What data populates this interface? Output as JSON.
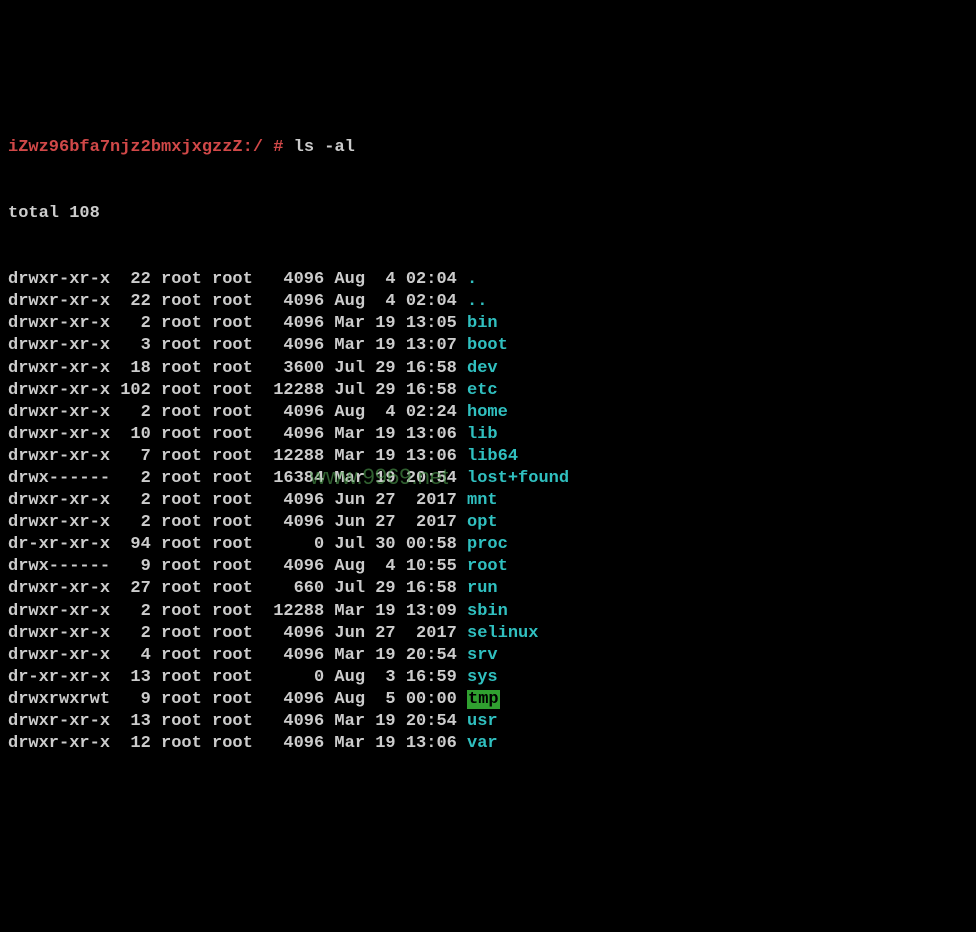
{
  "prompt": "iZwz96bfa7njz2bmxjxgzzZ:/ # ",
  "command": "ls -al",
  "total_line": "total 108",
  "listing": [
    {
      "perms": "drwxr-xr-x",
      "links": "22",
      "owner": "root",
      "group": "root",
      "size": "4096",
      "date": "Aug  4 02:04",
      "name": ".",
      "cls": "name-dir"
    },
    {
      "perms": "drwxr-xr-x",
      "links": "22",
      "owner": "root",
      "group": "root",
      "size": "4096",
      "date": "Aug  4 02:04",
      "name": "..",
      "cls": "name-dir"
    },
    {
      "perms": "drwxr-xr-x",
      "links": "2",
      "owner": "root",
      "group": "root",
      "size": "4096",
      "date": "Mar 19 13:05",
      "name": "bin",
      "cls": "name-dir"
    },
    {
      "perms": "drwxr-xr-x",
      "links": "3",
      "owner": "root",
      "group": "root",
      "size": "4096",
      "date": "Mar 19 13:07",
      "name": "boot",
      "cls": "name-dir"
    },
    {
      "perms": "drwxr-xr-x",
      "links": "18",
      "owner": "root",
      "group": "root",
      "size": "3600",
      "date": "Jul 29 16:58",
      "name": "dev",
      "cls": "name-dir"
    },
    {
      "perms": "drwxr-xr-x",
      "links": "102",
      "owner": "root",
      "group": "root",
      "size": "12288",
      "date": "Jul 29 16:58",
      "name": "etc",
      "cls": "name-dir"
    },
    {
      "perms": "drwxr-xr-x",
      "links": "2",
      "owner": "root",
      "group": "root",
      "size": "4096",
      "date": "Aug  4 02:24",
      "name": "home",
      "cls": "name-dir"
    },
    {
      "perms": "drwxr-xr-x",
      "links": "10",
      "owner": "root",
      "group": "root",
      "size": "4096",
      "date": "Mar 19 13:06",
      "name": "lib",
      "cls": "name-dir"
    },
    {
      "perms": "drwxr-xr-x",
      "links": "7",
      "owner": "root",
      "group": "root",
      "size": "12288",
      "date": "Mar 19 13:06",
      "name": "lib64",
      "cls": "name-dir"
    },
    {
      "perms": "drwx------",
      "links": "2",
      "owner": "root",
      "group": "root",
      "size": "16384",
      "date": "Mar 19 20:54",
      "name": "lost+found",
      "cls": "name-dir"
    },
    {
      "perms": "drwxr-xr-x",
      "links": "2",
      "owner": "root",
      "group": "root",
      "size": "4096",
      "date": "Jun 27  2017",
      "name": "mnt",
      "cls": "name-dir"
    },
    {
      "perms": "drwxr-xr-x",
      "links": "2",
      "owner": "root",
      "group": "root",
      "size": "4096",
      "date": "Jun 27  2017",
      "name": "opt",
      "cls": "name-dir"
    },
    {
      "perms": "dr-xr-xr-x",
      "links": "94",
      "owner": "root",
      "group": "root",
      "size": "0",
      "date": "Jul 30 00:58",
      "name": "proc",
      "cls": "name-dir"
    },
    {
      "perms": "drwx------",
      "links": "9",
      "owner": "root",
      "group": "root",
      "size": "4096",
      "date": "Aug  4 10:55",
      "name": "root",
      "cls": "name-dir"
    },
    {
      "perms": "drwxr-xr-x",
      "links": "27",
      "owner": "root",
      "group": "root",
      "size": "660",
      "date": "Jul 29 16:58",
      "name": "run",
      "cls": "name-dir"
    },
    {
      "perms": "drwxr-xr-x",
      "links": "2",
      "owner": "root",
      "group": "root",
      "size": "12288",
      "date": "Mar 19 13:09",
      "name": "sbin",
      "cls": "name-dir"
    },
    {
      "perms": "drwxr-xr-x",
      "links": "2",
      "owner": "root",
      "group": "root",
      "size": "4096",
      "date": "Jun 27  2017",
      "name": "selinux",
      "cls": "name-dir"
    },
    {
      "perms": "drwxr-xr-x",
      "links": "4",
      "owner": "root",
      "group": "root",
      "size": "4096",
      "date": "Mar 19 20:54",
      "name": "srv",
      "cls": "name-dir"
    },
    {
      "perms": "dr-xr-xr-x",
      "links": "13",
      "owner": "root",
      "group": "root",
      "size": "0",
      "date": "Aug  3 16:59",
      "name": "sys",
      "cls": "name-dir"
    },
    {
      "perms": "drwxrwxrwt",
      "links": "9",
      "owner": "root",
      "group": "root",
      "size": "4096",
      "date": "Aug  5 00:00",
      "name": "tmp",
      "cls": "name-sticky"
    },
    {
      "perms": "drwxr-xr-x",
      "links": "13",
      "owner": "root",
      "group": "root",
      "size": "4096",
      "date": "Mar 19 20:54",
      "name": "usr",
      "cls": "name-dir"
    },
    {
      "perms": "drwxr-xr-x",
      "links": "12",
      "owner": "root",
      "group": "root",
      "size": "4096",
      "date": "Mar 19 13:06",
      "name": "var",
      "cls": "name-dir"
    }
  ],
  "watermark": "www.9969.net"
}
